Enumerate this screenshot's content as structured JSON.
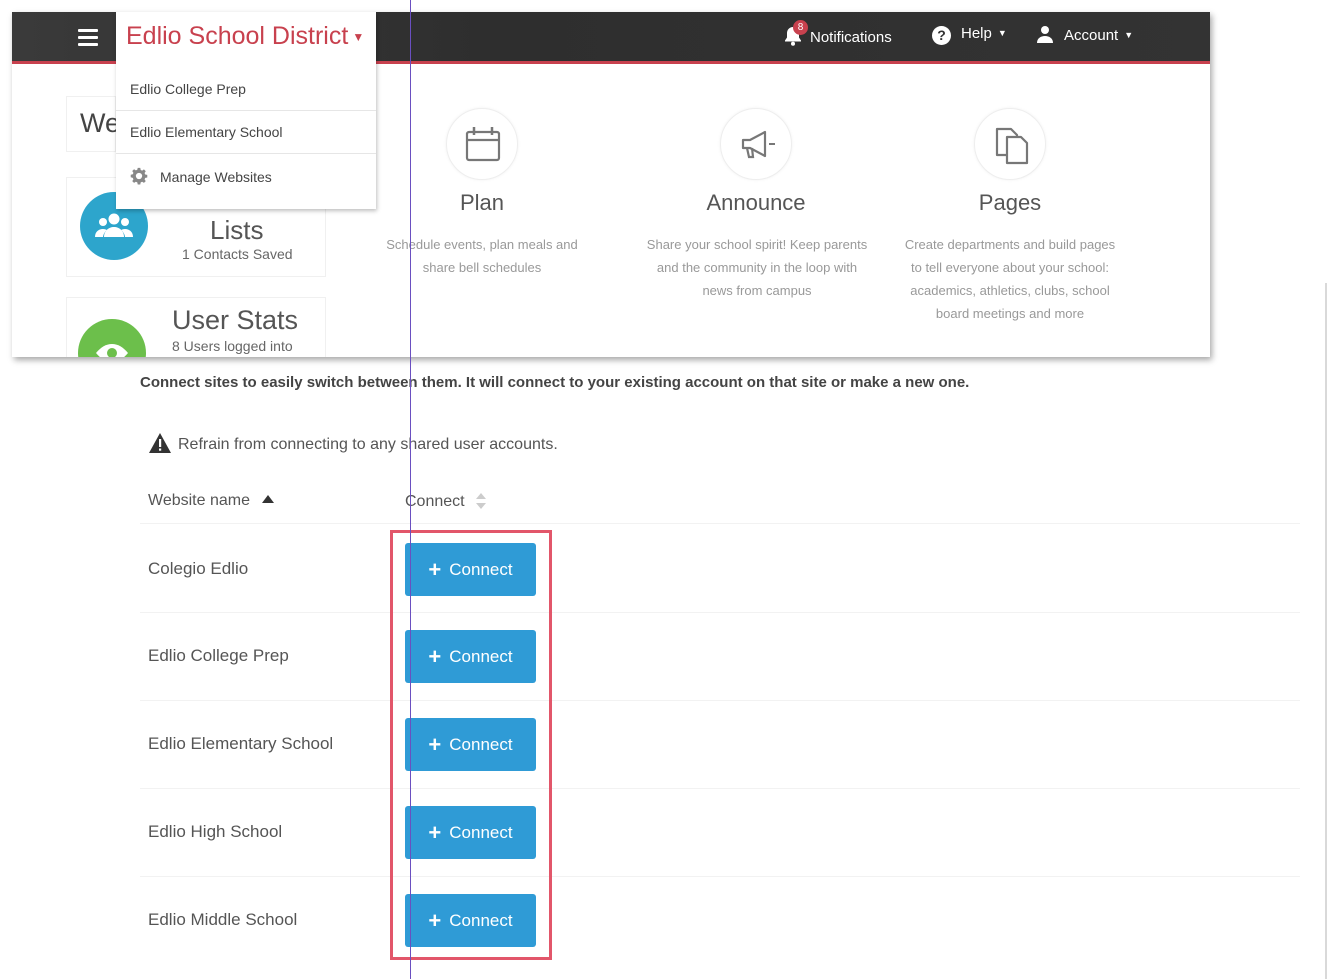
{
  "topbar": {
    "district_name": "Edlio School District",
    "notifications_label": "Notifications",
    "notifications_count": "8",
    "help_label": "Help",
    "account_label": "Account"
  },
  "district_menu": {
    "items": [
      "Edlio College Prep",
      "Edlio Elementary School"
    ],
    "manage_label": "Manage Websites"
  },
  "dashboard": {
    "welcome_text": "We",
    "contact_lists": {
      "title": "Lists",
      "subtitle": "1 Contacts Saved"
    },
    "user_stats": {
      "title": "User Stats",
      "subtitle": "8 Users logged into"
    }
  },
  "features": [
    {
      "title": "Plan",
      "desc_lines": [
        "Schedule events, plan meals and",
        "share bell schedules"
      ]
    },
    {
      "title": "Announce",
      "desc_lines": [
        "Share your school spirit! Keep parents",
        "and the community in the loop with",
        "news from campus"
      ]
    },
    {
      "title": "Pages",
      "desc_lines": [
        "Create departments and build pages",
        "to tell everyone about your school:",
        "academics, athletics, clubs, school",
        "board meetings and more"
      ]
    }
  ],
  "connect_page": {
    "intro": "Connect sites to easily switch between them. It will connect to your existing account on that site or make a new one.",
    "warning": "Refrain from connecting to any shared user accounts.",
    "columns": {
      "name": "Website name",
      "connect": "Connect"
    },
    "button_label": "Connect",
    "sites": [
      "Colegio Edlio",
      "Edlio College Prep",
      "Edlio Elementary School",
      "Edlio High School",
      "Edlio Middle School"
    ]
  }
}
